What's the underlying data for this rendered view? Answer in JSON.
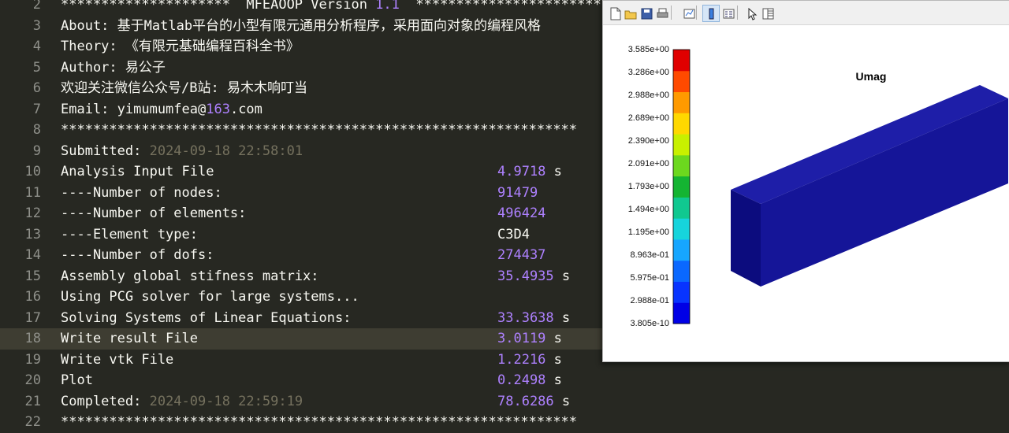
{
  "editor": {
    "lines": [
      {
        "no": "2",
        "text": "*********************  MFEAOOP Version ",
        "num": "1.1",
        "text2": "  ************************"
      },
      {
        "no": "3",
        "text": "About: 基于Matlab平台的小型有限元通用分析程序，采用面向对象的编程风格"
      },
      {
        "no": "4",
        "text": "Theory: 《有限元基础编程百科全书》"
      },
      {
        "no": "5",
        "text": "Author: 易公子"
      },
      {
        "no": "6",
        "text": "欢迎关注微信公众号/B站: 易木木响叮当"
      },
      {
        "no": "7",
        "text": "Email: yimumumfea@",
        "num": "163",
        "text2": ".com"
      },
      {
        "no": "8",
        "text": "****************************************************************"
      },
      {
        "no": "9",
        "text": "Submitted: ",
        "gray": "2024-09-18 22:58:01"
      },
      {
        "no": "10",
        "text": "Analysis Input File",
        "value": "4.9718",
        "unit": " s"
      },
      {
        "no": "11",
        "text": "----Number of nodes:",
        "value": "91479"
      },
      {
        "no": "12",
        "text": "----Number of elements:",
        "value": "496424"
      },
      {
        "no": "13",
        "text": "----Element type:",
        "plain_value": "C3D4"
      },
      {
        "no": "14",
        "text": "----Number of dofs:",
        "value": "274437"
      },
      {
        "no": "15",
        "text": "Assembly global stifness matrix:",
        "value": "35.4935",
        "unit": " s"
      },
      {
        "no": "16",
        "text": "Using PCG solver for large systems..."
      },
      {
        "no": "17",
        "text": "Solving Systems of Linear Equations:",
        "value": "33.3638",
        "unit": " s"
      },
      {
        "no": "18",
        "text": "Write result File",
        "value": "3.0119",
        "unit": " s",
        "current": true
      },
      {
        "no": "19",
        "text": "Write vtk File",
        "value": "1.2216",
        "unit": " s"
      },
      {
        "no": "20",
        "text": "Plot",
        "value": "0.2498",
        "unit": " s"
      },
      {
        "no": "21",
        "text": "Completed: ",
        "gray": "2024-09-18 22:59:19",
        "value": "78.6286",
        "unit": " s"
      },
      {
        "no": "22",
        "text": "****************************************************************"
      }
    ]
  },
  "figure": {
    "title": "Umag",
    "toolbar": [
      "new-figure-icon",
      "open-file-icon",
      "save-icon",
      "print-icon",
      "link-plot-icon",
      "insert-colorbar-icon",
      "insert-legend-icon",
      "edit-plot-icon",
      "property-inspector-icon"
    ],
    "colorbar_labels": [
      "3.585e+00",
      "3.286e+00",
      "2.988e+00",
      "2.689e+00",
      "2.390e+00",
      "2.091e+00",
      "1.793e+00",
      "1.494e+00",
      "1.195e+00",
      "8.963e-01",
      "5.975e-01",
      "2.988e-01",
      "3.805e-10"
    ],
    "colorbar_colors": [
      "#e00000",
      "#ff4a00",
      "#ff9a00",
      "#ffd800",
      "#c8f000",
      "#6cd81e",
      "#14b432",
      "#10c890",
      "#16d4dc",
      "#16a6ff",
      "#0a68ff",
      "#0834ff",
      "#0000e6"
    ],
    "model_colors": {
      "top": "#1e1ea8",
      "front": "#151598",
      "side": "#0c0c7e"
    }
  }
}
